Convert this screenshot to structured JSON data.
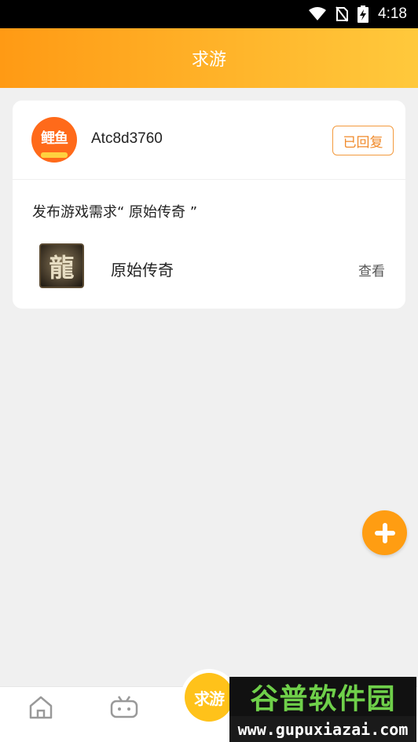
{
  "status_bar": {
    "time": "4:18"
  },
  "header": {
    "title": "求游"
  },
  "post": {
    "avatar_text": "鲤鱼",
    "username": "Atc8d3760",
    "badge": "已回复",
    "request_text": "发布游戏需求“ 原始传奇 ”",
    "game": {
      "icon_glyph": "龍",
      "name": "原始传奇",
      "view_label": "查看"
    }
  },
  "fab": {
    "icon": "plus-icon"
  },
  "bottom_nav": {
    "center_label": "求游"
  },
  "watermark": {
    "title": "谷普软件园",
    "url": "www.gupuxiazai.com"
  },
  "colors": {
    "header_start": "#ff9a14",
    "header_end": "#ffc93c",
    "accent": "#ff9d12",
    "badge_border": "#f39a3e"
  }
}
